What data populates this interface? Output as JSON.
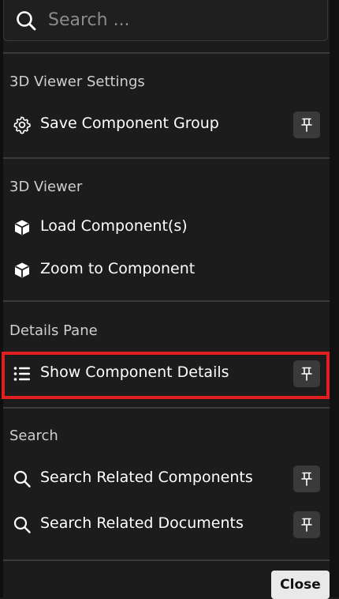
{
  "search": {
    "placeholder": "Search ..."
  },
  "sections": [
    {
      "title": "3D Viewer Settings",
      "items": [
        {
          "label": "Save Component Group",
          "icon": "gear-icon",
          "pinned": true
        }
      ]
    },
    {
      "title": "3D Viewer",
      "items": [
        {
          "label": "Load Component(s)",
          "icon": "cube-icon",
          "pinned": false
        },
        {
          "label": "Zoom to Component",
          "icon": "cube-icon",
          "pinned": false
        }
      ]
    },
    {
      "title": "Details Pane",
      "items": [
        {
          "label": "Show Component Details",
          "icon": "list-icon",
          "pinned": true,
          "highlighted": true
        }
      ]
    },
    {
      "title": "Search",
      "items": [
        {
          "label": "Search Related Components",
          "icon": "search-icon",
          "pinned": true
        },
        {
          "label": "Search Related Documents",
          "icon": "search-icon",
          "pinned": true
        }
      ]
    }
  ],
  "footer": {
    "close_label": "Close"
  },
  "colors": {
    "background": "#1c1c1c",
    "highlight": "#e0201f",
    "pin_button": "#3a3a3a",
    "close_button": "#e9e9e9"
  }
}
